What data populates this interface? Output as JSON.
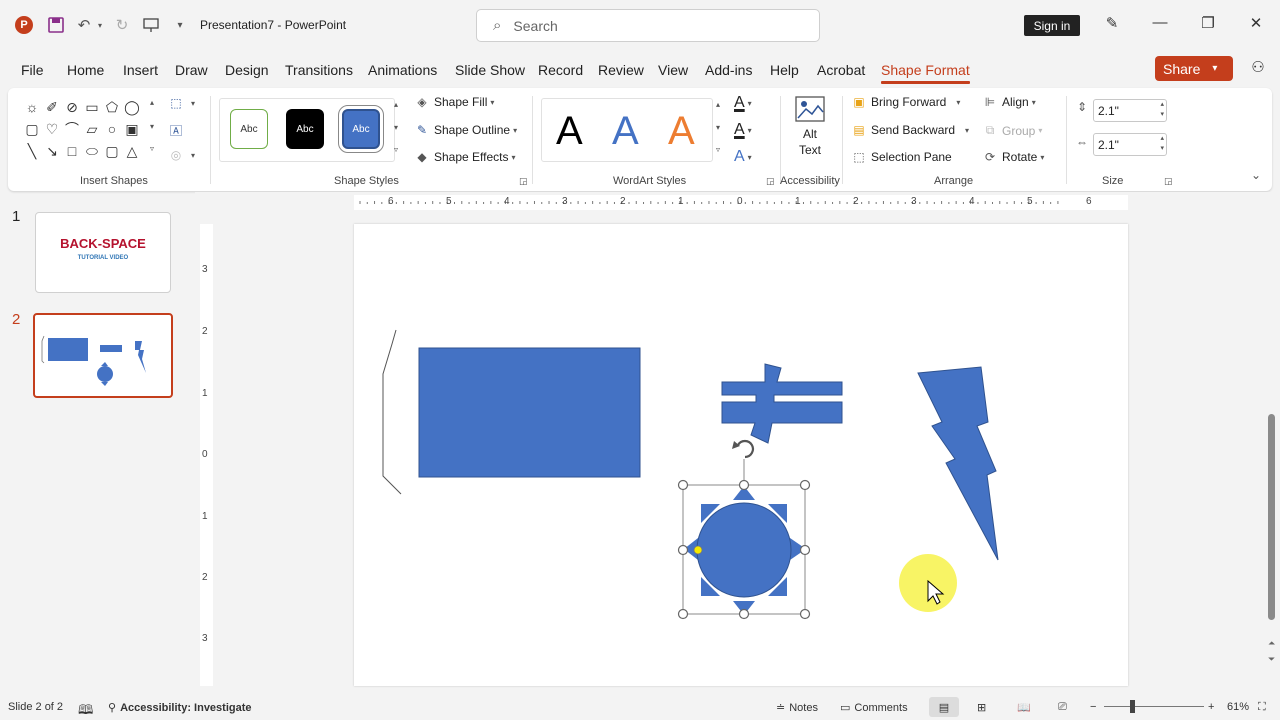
{
  "app": {
    "logo_letter": "P",
    "document_title": "Presentation7  -  PowerPoint",
    "search_placeholder": "Search",
    "sign_in": "Sign in",
    "accent": "#c43e1c",
    "shape_fill": "#4472c4"
  },
  "menu_tabs": [
    "File",
    "Home",
    "Insert",
    "Draw",
    "Design",
    "Transitions",
    "Animations",
    "Slide Show",
    "Record",
    "Review",
    "View",
    "Add-ins",
    "Help",
    "Acrobat",
    "Shape Format"
  ],
  "active_tab": "Shape Format",
  "share_label": "Share",
  "ribbon": {
    "groups": {
      "insert_shapes": "Insert Shapes",
      "shape_styles": "Shape Styles",
      "wordart_styles": "WordArt Styles",
      "accessibility": "Accessibility",
      "arrange": "Arrange",
      "size": "Size"
    },
    "style_thumb_label": "Abc",
    "shape_fill": "Shape Fill",
    "shape_outline": "Shape Outline",
    "shape_effects": "Shape Effects",
    "wordart_letter": "A",
    "alt_text_line1": "Alt",
    "alt_text_line2": "Text",
    "bring_forward": "Bring Forward",
    "send_backward": "Send Backward",
    "selection_pane": "Selection Pane",
    "align": "Align",
    "group": "Group",
    "rotate": "Rotate",
    "height_value": "2.1\"",
    "width_value": "2.1\""
  },
  "thumbnails": [
    {
      "number": "1",
      "title": "BACK-SPACE",
      "subtitle": "TUTORIAL VIDEO"
    },
    {
      "number": "2"
    }
  ],
  "hruler_numbers": [
    "6",
    "5",
    "4",
    "3",
    "2",
    "1",
    "0",
    "1",
    "2",
    "3",
    "4",
    "5",
    "6"
  ],
  "vruler_numbers": [
    "3",
    "2",
    "1",
    "0",
    "1",
    "2",
    "3"
  ],
  "status": {
    "slide_counter": "Slide 2 of 2",
    "accessibility": "Accessibility: Investigate",
    "notes": "Notes",
    "comments": "Comments",
    "zoom": "61%"
  }
}
